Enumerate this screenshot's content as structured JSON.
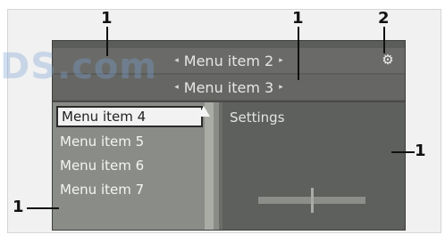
{
  "menu": {
    "row1": {
      "label": "Menu item 2"
    },
    "row2": {
      "label": "Menu item 3"
    },
    "items": [
      {
        "label": "Menu item 4",
        "selected": true
      },
      {
        "label": "Menu item 5",
        "selected": false
      },
      {
        "label": "Menu item 6",
        "selected": false
      },
      {
        "label": "Menu item 7",
        "selected": false
      }
    ]
  },
  "right_panel": {
    "title": "Settings"
  },
  "callouts": {
    "top_left": "1",
    "top_mid": "1",
    "top_right": "2",
    "right": "1",
    "left": "1"
  },
  "watermark": {
    "text": "DS.com"
  },
  "icons": {
    "left_arrow": "left-arrow-icon",
    "right_arrow": "right-arrow-icon",
    "settings": "settings-icon",
    "scroll_up": "scroll-up-icon"
  },
  "colors": {
    "screen_bg": "#5b5d5a",
    "left_panel_bg": "#8a8d87",
    "selection_bg": "#f2f2f2",
    "text_light": "#e6e6e6"
  }
}
